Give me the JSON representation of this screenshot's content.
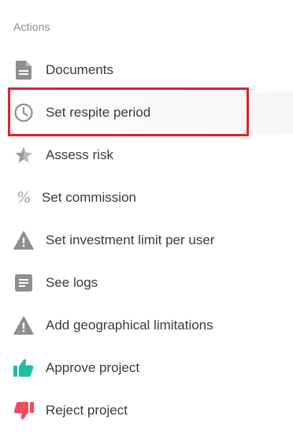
{
  "section": {
    "title": "Actions"
  },
  "actions": [
    {
      "label": "Documents",
      "icon": "document-icon"
    },
    {
      "label": "Set respite period",
      "icon": "clock-icon"
    },
    {
      "label": "Assess risk",
      "icon": "star-icon"
    },
    {
      "label": "Set commission",
      "icon": "percent-icon"
    },
    {
      "label": "Set investment limit per user",
      "icon": "warning-icon"
    },
    {
      "label": "See logs",
      "icon": "log-icon"
    },
    {
      "label": "Add geographical limitations",
      "icon": "warning-icon"
    },
    {
      "label": "Approve project",
      "icon": "thumbs-up-icon"
    },
    {
      "label": "Reject project",
      "icon": "thumbs-down-icon"
    }
  ],
  "highlighted_action": "Set respite period",
  "colors": {
    "icon_gray": "#8f8f8f",
    "approve": "#1cbfa4",
    "reject": "#ef4d5c",
    "highlight_border": "#d9232e"
  },
  "icons": {
    "percent_glyph": "%"
  }
}
